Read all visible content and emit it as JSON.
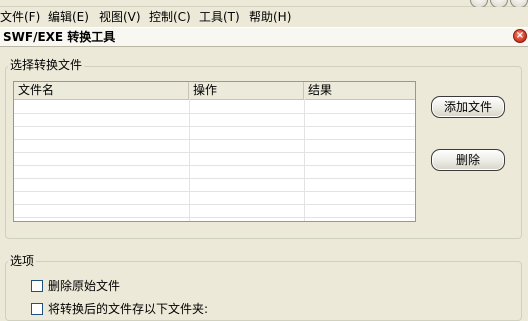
{
  "menu": {
    "items": [
      {
        "label": "文件(F)"
      },
      {
        "label": "编辑(E)"
      },
      {
        "label": "视图(V)"
      },
      {
        "label": "控制(C)"
      },
      {
        "label": "工具(T)"
      },
      {
        "label": "帮助(H)"
      }
    ]
  },
  "header": {
    "title": "SWF/EXE 转换工具"
  },
  "select_group": {
    "label": "选择转换文件",
    "columns": [
      "文件名",
      "操作",
      "结果"
    ],
    "add_button": "添加文件",
    "delete_button": "删除"
  },
  "options_group": {
    "label": "选项",
    "option1": "删除原始文件",
    "option2": "将转换后的文件存以下文件夹:"
  }
}
